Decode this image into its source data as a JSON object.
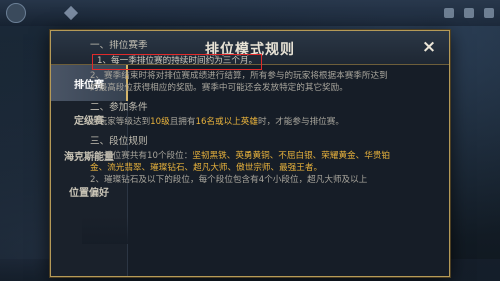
{
  "dialog": {
    "title": "排位模式规则",
    "close_label": "×"
  },
  "tabs": [
    {
      "label": "排位赛"
    },
    {
      "label": "定级赛"
    },
    {
      "label": "海克斯能量"
    },
    {
      "label": "位置偏好"
    }
  ],
  "content": {
    "s1_title": "一、排位赛季",
    "s1_p1": "1、每一季排位赛的持续时间约为三个月。",
    "s1_p2": "2、赛季结束时将对排位赛成绩进行结算，所有参与的玩家将根据本赛季所达到的最高段位获得相应的奖励。赛季中可能还会发放特定的其它奖励。",
    "s2_title": "二、参加条件",
    "s2_p1_a": "当玩家等级达到",
    "s2_p1_b": "10级",
    "s2_p1_c": "且拥有",
    "s2_p1_d": "16名或以上英雄",
    "s2_p1_e": "时，才能参与排位赛。",
    "s3_title": "三、段位规则",
    "s3_p1_a": "1、排位赛共有10个段位：",
    "s3_p1_b": "坚韧黑铁、英勇黄铜、不屈白银、荣耀黄金、华贵铂金、流光翡翠、璀璨钻石、超凡大师、傲世宗师、最强王者。",
    "s3_p2": "2、璀璨钻石及以下的段位，每个段位包含有4个小段位，超凡大师及以上"
  },
  "colors": {
    "accent_gold": "#e8b23c",
    "highlight_red": "#e02a2a",
    "frame_gold": "#b59a58"
  }
}
